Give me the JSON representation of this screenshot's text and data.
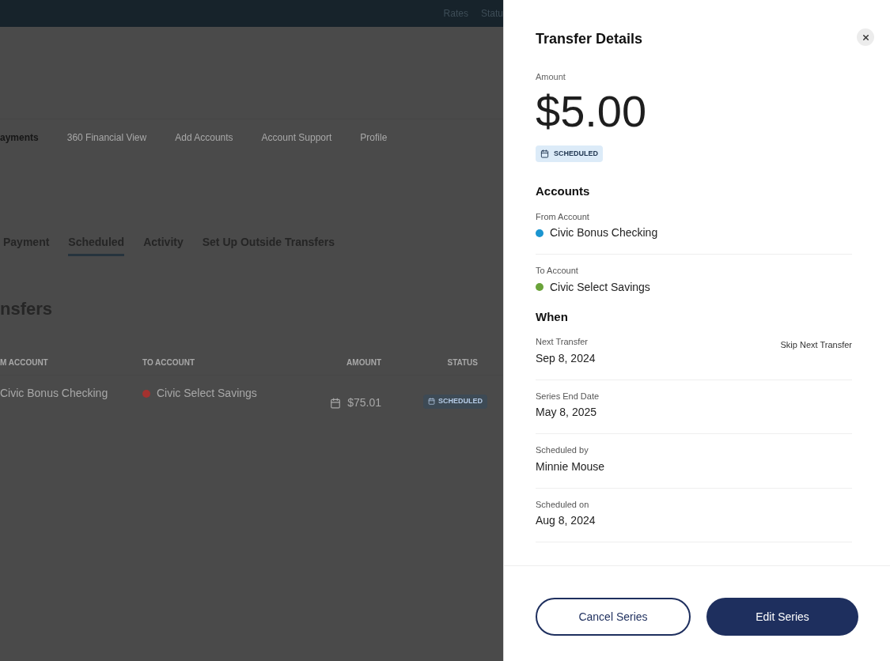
{
  "top_bar": {
    "links": [
      "Rates",
      "Statu"
    ]
  },
  "nav": {
    "items": [
      {
        "label": "ayments",
        "selected": true
      },
      {
        "label": "360 Financial View",
        "selected": false
      },
      {
        "label": "Add Accounts",
        "selected": false
      },
      {
        "label": "Account Support",
        "selected": false
      },
      {
        "label": "Profile",
        "selected": false
      }
    ]
  },
  "tabs": [
    {
      "label": "Payment",
      "selected": false
    },
    {
      "label": "Scheduled",
      "selected": true
    },
    {
      "label": "Activity",
      "selected": false
    },
    {
      "label": "Set Up Outside Transfers",
      "selected": false
    }
  ],
  "heading": "nsfers",
  "table": {
    "columns": [
      "M ACCOUNT",
      "TO ACCOUNT",
      "AMOUNT",
      "STATUS"
    ],
    "rows": [
      {
        "from": "Civic Bonus Checking",
        "to": "Civic Select Savings",
        "color": "#a3322f",
        "amount": "$75.01",
        "status": "SCHEDULED"
      }
    ]
  },
  "drawer": {
    "title": "Transfer Details",
    "amount_label": "Amount",
    "amount": "$5.00",
    "status": "SCHEDULED",
    "accounts_heading": "Accounts",
    "accounts": [
      {
        "label": "From Account",
        "name": "Civic Bonus Checking",
        "color": "#1b95d0"
      },
      {
        "label": "To Account",
        "name": "Civic Select Savings",
        "color": "#6aa33a"
      }
    ],
    "when_heading": "When",
    "when": [
      {
        "label": "Next Transfer",
        "value": "Sep 8, 2024",
        "action": "Skip Next Transfer"
      },
      {
        "label": "Series End Date",
        "value": "May 8, 2025"
      },
      {
        "label": "Scheduled by",
        "value": "Minnie Mouse"
      },
      {
        "label": "Scheduled on",
        "value": "Aug 8, 2024"
      }
    ],
    "buttons": [
      {
        "label": "Cancel Series",
        "kind": "outline"
      },
      {
        "label": "Edit Series",
        "kind": "primary"
      }
    ]
  }
}
